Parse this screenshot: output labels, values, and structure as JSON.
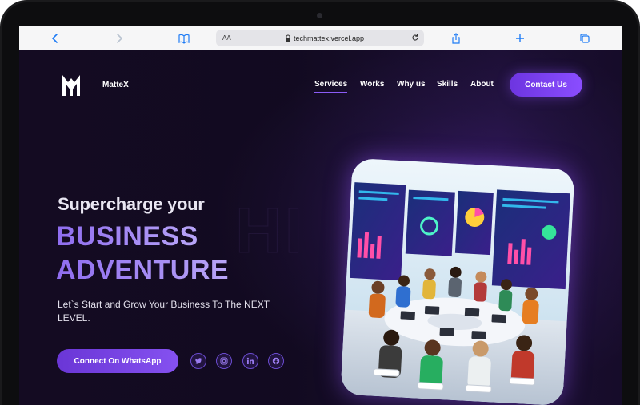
{
  "browser": {
    "aa_label": "AA",
    "url": "techmattex.vercel.app"
  },
  "nav": {
    "brand": "MatteX",
    "items": [
      "Services",
      "Works",
      "Why us",
      "Skills",
      "About"
    ],
    "active_item": "Services",
    "contact_label": "Contact Us"
  },
  "hero": {
    "heading_small": "Supercharge your",
    "heading_line1": "BUSINESS",
    "heading_line2": "ADVENTURE",
    "subtitle": "Let`s Start and Grow Your Business To The NEXT LEVEL.",
    "cta_label": "Connect On WhatsApp",
    "social_icons": [
      "twitter-icon",
      "instagram-icon",
      "linkedin-icon",
      "facebook-icon"
    ]
  },
  "colors": {
    "accent": "#7c4dff",
    "background": "#110a20",
    "browser_blue": "#1f7cf5"
  }
}
